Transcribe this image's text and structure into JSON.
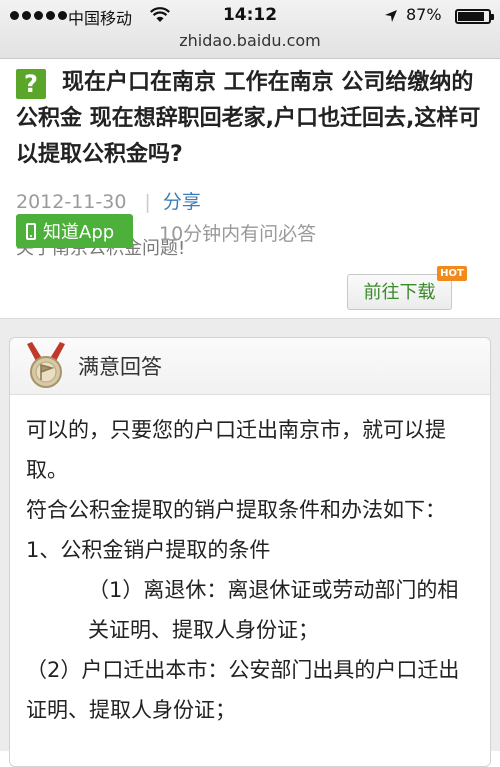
{
  "status_bar": {
    "carrier": "中国移动",
    "time": "14:12",
    "battery_percent": "87%",
    "battery_level": 0.87
  },
  "url": "zhidao.baidu.com",
  "question": {
    "icon": "question-mark-icon",
    "icon_glyph": "?",
    "title": "现在户口在南京 工作在南京 公司给缴纳的公积金 现在想辞职回老家,户口也迁回去,这样可以提取公积金吗?",
    "date": "2012-11-30",
    "separator": "|",
    "share_label": "分享",
    "note": "关于南京公积金问题!"
  },
  "app_promo": {
    "app_button_label": "知道App",
    "slogan": "10分钟内有问必答",
    "goto_button_label": "前往下载",
    "hot_badge": "HOT"
  },
  "answer": {
    "header": "满意回答",
    "paragraphs": [
      "可以的，只要您的户口迁出南京市，就可以提取。",
      "符合公积金提取的销户提取条件和办法如下：",
      "1、公积金销户提取的条件",
      "（1）离退休：离退休证或劳动部门的相关证明、提取人身份证；",
      "（2）户口迁出本市：公安部门出具的户口迁出证明、提取人身份证；"
    ]
  },
  "colors": {
    "accent_green": "#4db03b",
    "link_blue": "#3c7fb8",
    "hot_orange": "#f08a1a"
  }
}
